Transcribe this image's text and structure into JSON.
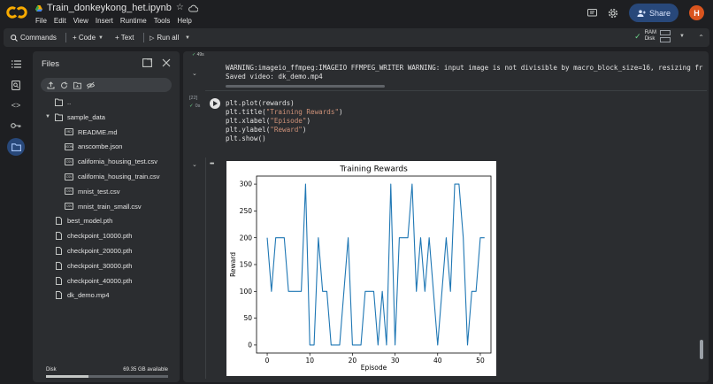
{
  "header": {
    "notebook_title": "Train_donkeykong_het.ipynb",
    "menu": [
      "File",
      "Edit",
      "View",
      "Insert",
      "Runtime",
      "Tools",
      "Help"
    ],
    "share_label": "Share",
    "avatar_letter": "H"
  },
  "toolbar": {
    "commands_label": "Commands",
    "code_label": "+ Code",
    "text_label": "+ Text",
    "run_all_label": "Run all",
    "ram_label": "RAM",
    "disk_label": "Disk"
  },
  "files_panel": {
    "title": "Files",
    "items": [
      {
        "name": "..",
        "kind": "folder",
        "level": 1
      },
      {
        "name": "sample_data",
        "kind": "folder",
        "level": 1,
        "expanded": true
      },
      {
        "name": "README.md",
        "kind": "file",
        "badge": "MD",
        "level": 2
      },
      {
        "name": "anscombe.json",
        "kind": "file",
        "badge": "JSON",
        "level": 2
      },
      {
        "name": "california_housing_test.csv",
        "kind": "file",
        "badge": "CSV",
        "level": 2
      },
      {
        "name": "california_housing_train.csv",
        "kind": "file",
        "badge": "CSV",
        "level": 2
      },
      {
        "name": "mnist_test.csv",
        "kind": "file",
        "badge": "CSV",
        "level": 2
      },
      {
        "name": "mnist_train_small.csv",
        "kind": "file",
        "badge": "CSV",
        "level": 2
      },
      {
        "name": "best_model.pth",
        "kind": "file",
        "level": 1
      },
      {
        "name": "checkpoint_10000.pth",
        "kind": "file",
        "level": 1
      },
      {
        "name": "checkpoint_20000.pth",
        "kind": "file",
        "level": 1
      },
      {
        "name": "checkpoint_30000.pth",
        "kind": "file",
        "level": 1
      },
      {
        "name": "checkpoint_40000.pth",
        "kind": "file",
        "level": 1
      },
      {
        "name": "dk_demo.mp4",
        "kind": "file",
        "level": 1
      }
    ],
    "disk_label": "Disk",
    "disk_available": "69.35 GB available",
    "disk_used_fraction": 0.35
  },
  "notebook": {
    "prev_cell_status": "49s",
    "output_lines": [
      "WARNING:imageio_ffmpeg:IMAGEIO FFMPEG_WRITER WARNING: input image is not divisible by macro_block_size=16, resizing fr",
      "Saved video: dk_demo.mp4"
    ],
    "exec_count": "[22]",
    "exec_time": "0s",
    "code_lines": [
      [
        "plt.plot(rewards)"
      ],
      [
        "plt.title(",
        "\"Training Rewards\"",
        ")"
      ],
      [
        "plt.xlabel(",
        "\"Episode\"",
        ")"
      ],
      [
        "plt.ylabel(",
        "\"Reward\"",
        ")"
      ],
      [
        "plt.show()"
      ]
    ]
  },
  "chart_data": {
    "type": "line",
    "title": "Training Rewards",
    "xlabel": "Episode",
    "ylabel": "Reward",
    "xlim": [
      -2.5,
      52.5
    ],
    "ylim": [
      -15,
      315
    ],
    "xticks": [
      0,
      10,
      20,
      30,
      40,
      50
    ],
    "yticks": [
      0,
      50,
      100,
      150,
      200,
      250,
      300
    ],
    "grid": false,
    "series": [
      {
        "color": "#1f77b4",
        "x": [
          0,
          1,
          2,
          3,
          4,
          5,
          6,
          7,
          8,
          9,
          10,
          11,
          12,
          13,
          14,
          15,
          16,
          17,
          18,
          19,
          20,
          21,
          22,
          23,
          24,
          25,
          26,
          27,
          28,
          29,
          30,
          31,
          32,
          33,
          34,
          35,
          36,
          37,
          38,
          39,
          40,
          41,
          42,
          43,
          44,
          45,
          46,
          47,
          48,
          49,
          50,
          51
        ],
        "values": [
          200,
          100,
          200,
          200,
          200,
          100,
          100,
          100,
          100,
          300,
          0,
          0,
          200,
          100,
          100,
          0,
          0,
          0,
          100,
          200,
          0,
          0,
          0,
          100,
          100,
          100,
          0,
          100,
          0,
          300,
          0,
          200,
          200,
          200,
          300,
          100,
          200,
          100,
          200,
          100,
          0,
          100,
          200,
          100,
          300,
          300,
          200,
          0,
          100,
          100,
          200,
          200
        ]
      }
    ]
  }
}
